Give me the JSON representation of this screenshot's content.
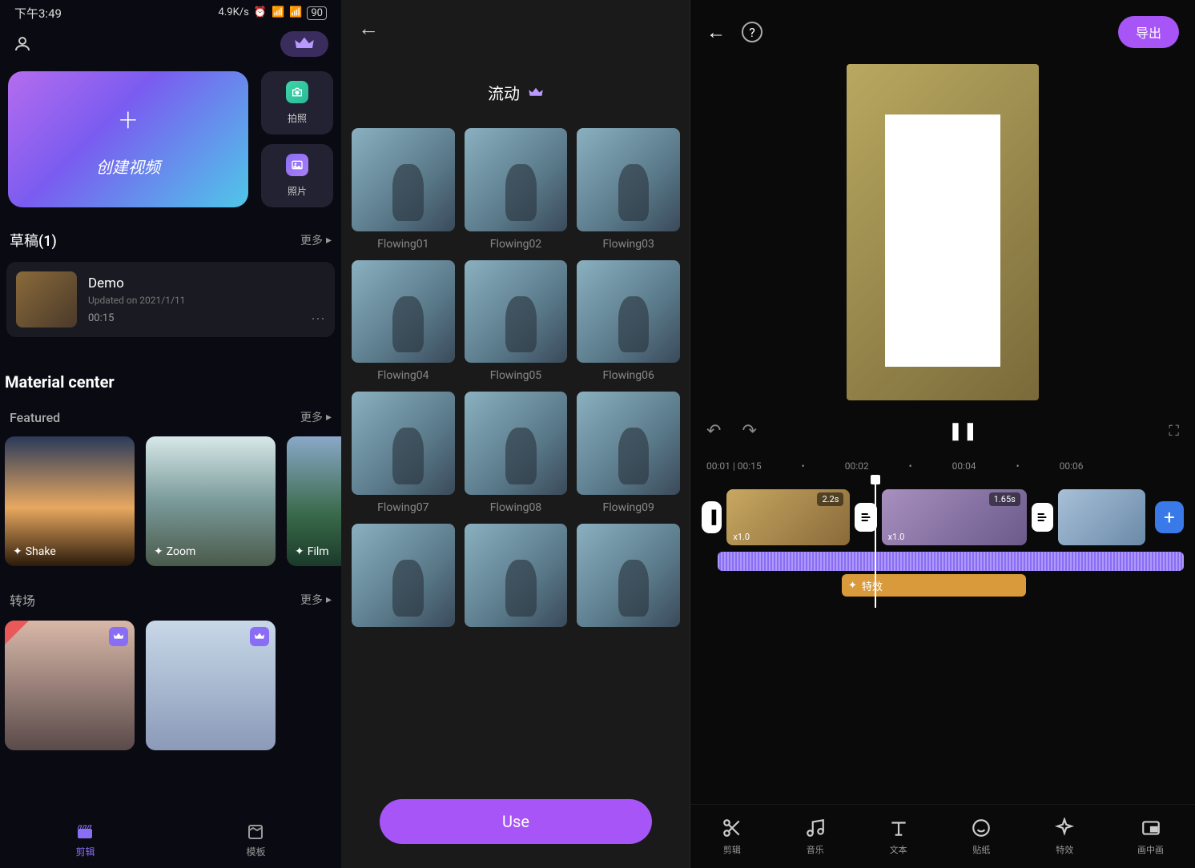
{
  "screen1": {
    "statusbar": {
      "time": "下午3:49",
      "speed": "4.9K/s",
      "battery": "90"
    },
    "create_label": "创建视频",
    "side_btns": {
      "camera": "拍照",
      "photo": "照片"
    },
    "drafts": {
      "header": "草稿(1)",
      "more": "更多"
    },
    "draft": {
      "title": "Demo",
      "updated": "Updated on 2021/1/11",
      "duration": "00:15"
    },
    "material_center": "Material center",
    "featured": {
      "header": "Featured",
      "more": "更多",
      "items": [
        "Shake",
        "Zoom",
        "Film"
      ]
    },
    "transitions": {
      "header": "转场",
      "more": "更多"
    },
    "nav": {
      "tab1": "剪辑",
      "tab2": "模板"
    }
  },
  "screen2": {
    "title": "流动",
    "items": [
      "Flowing01",
      "Flowing02",
      "Flowing03",
      "Flowing04",
      "Flowing05",
      "Flowing06",
      "Flowing07",
      "Flowing08",
      "Flowing09"
    ],
    "use_btn": "Use"
  },
  "screen3": {
    "export": "导出",
    "time_current": "00:01 | 00:15",
    "time_marks": [
      "00:02",
      "00:04",
      "00:06"
    ],
    "clip1": {
      "dur": "2.2s",
      "speed": "x1.0"
    },
    "clip2": {
      "dur": "1.65s",
      "speed": "x1.0"
    },
    "fx_label": "特效",
    "tools": [
      "剪辑",
      "音乐",
      "文本",
      "贴纸",
      "特效",
      "画中画"
    ]
  }
}
